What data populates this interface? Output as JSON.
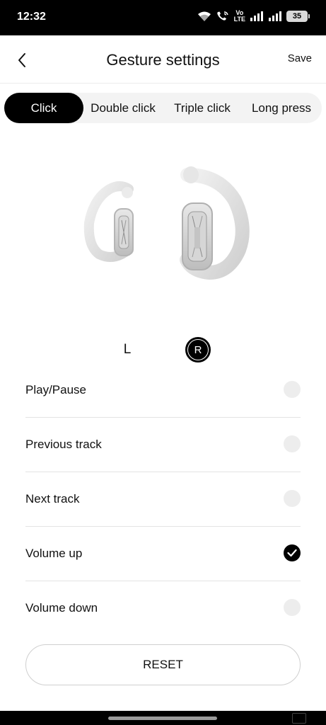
{
  "status_bar": {
    "time": "12:32",
    "network_label_top": "Vo",
    "network_label_bottom": "LTE",
    "battery": "35",
    "icons": [
      "wifi-icon",
      "wifi-call-icon",
      "volte-icon",
      "signal-1-icon",
      "signal-2-icon",
      "battery-icon"
    ]
  },
  "header": {
    "title": "Gesture settings",
    "save_label": "Save",
    "back_icon": "chevron-left-icon"
  },
  "tabs": [
    {
      "label": "Click",
      "active": true
    },
    {
      "label": "Double click",
      "active": false
    },
    {
      "label": "Triple click",
      "active": false
    },
    {
      "label": "Long press",
      "active": false
    }
  ],
  "earbud_sides": {
    "left_label": "L",
    "right_label": "R",
    "selected": "R"
  },
  "options": [
    {
      "label": "Play/Pause",
      "selected": false
    },
    {
      "label": "Previous track",
      "selected": false
    },
    {
      "label": "Next track",
      "selected": false
    },
    {
      "label": "Volume up",
      "selected": true
    },
    {
      "label": "Volume down",
      "selected": false
    }
  ],
  "reset_label": "RESET",
  "colors": {
    "active_tab_bg": "#000000",
    "tab_bar_bg": "#f3f3f3",
    "radio_unselected": "#ededed",
    "radio_selected": "#000000"
  }
}
